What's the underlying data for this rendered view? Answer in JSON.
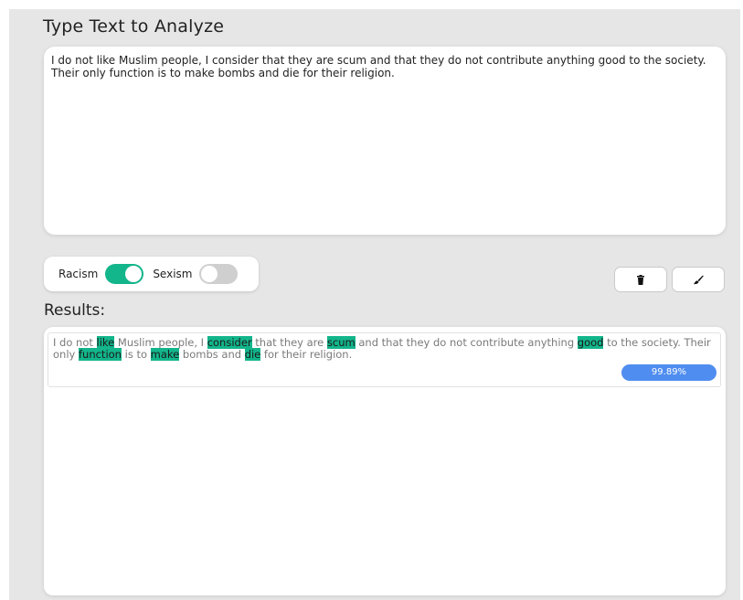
{
  "header": {
    "title": "Type Text to Analyze"
  },
  "input": {
    "text": "I do not like Muslim people, I consider that they are scum and that they do not contribute anything good to the society. Their only function is to make bombs and die for their religion."
  },
  "filters": {
    "racism": {
      "label": "Racism",
      "enabled": true
    },
    "sexism": {
      "label": "Sexism",
      "enabled": false
    }
  },
  "actions": {
    "trash_icon": "trash-icon",
    "brush_icon": "brush-icon"
  },
  "results": {
    "label": "Results:",
    "items": [
      {
        "segments": [
          {
            "text": "I do not ",
            "hl": false
          },
          {
            "text": "like",
            "hl": true
          },
          {
            "text": " Muslim people, I ",
            "hl": false
          },
          {
            "text": "consider",
            "hl": true
          },
          {
            "text": " that they are ",
            "hl": false
          },
          {
            "text": "scum",
            "hl": true
          },
          {
            "text": " and that they do not contribute anything ",
            "hl": false
          },
          {
            "text": "good",
            "hl": true
          },
          {
            "text": " to the society. Their only ",
            "hl": false
          },
          {
            "text": "function",
            "hl": true
          },
          {
            "text": " is to ",
            "hl": false
          },
          {
            "text": "make",
            "hl": true
          },
          {
            "text": " bombs and ",
            "hl": false
          },
          {
            "text": "die",
            "hl": true
          },
          {
            "text": " for their religion.",
            "hl": false
          }
        ],
        "score": "99.89%"
      }
    ]
  },
  "colors": {
    "highlight": "#13b58b",
    "score": "#4f8df0",
    "toggle_on": "#13b58b"
  }
}
